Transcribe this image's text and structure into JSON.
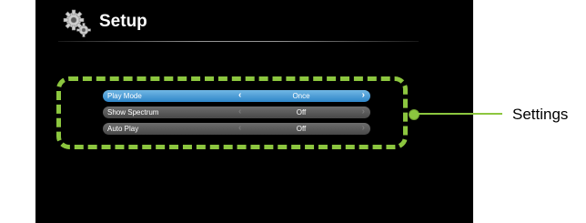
{
  "header": {
    "title": "Setup",
    "icon": "gear-icon"
  },
  "settings": {
    "rows": [
      {
        "label": "Play Mode",
        "value": "Once",
        "selected": true
      },
      {
        "label": "Show Spectrum",
        "value": "Off",
        "selected": false
      },
      {
        "label": "Auto Play",
        "value": "Off",
        "selected": false
      }
    ],
    "arrow_left": "‹",
    "arrow_right": "›"
  },
  "annotation": {
    "label": "Settings",
    "color": "#8cc63f"
  },
  "colors": {
    "selected_row": "#3a8fcf",
    "row": "#5a5a5a",
    "background": "#000000"
  }
}
